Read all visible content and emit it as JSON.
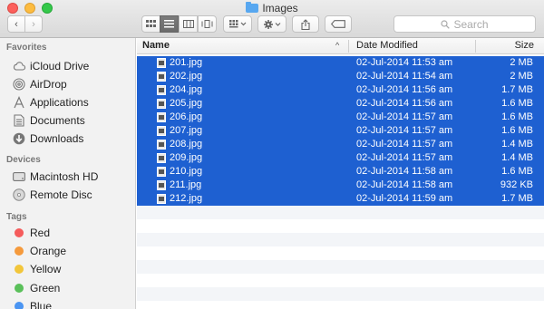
{
  "window": {
    "title": "Images"
  },
  "toolbar": {
    "back_glyph": "‹",
    "forward_glyph": "›",
    "search_placeholder": "Search",
    "view_modes": [
      "icon-view",
      "list-view",
      "column-view",
      "cover-flow-view"
    ],
    "selected_view": "list-view"
  },
  "sidebar": {
    "favorites_header": "Favorites",
    "favorites": [
      {
        "label": "iCloud Drive",
        "icon": "cloud-icon"
      },
      {
        "label": "AirDrop",
        "icon": "airdrop-icon"
      },
      {
        "label": "Applications",
        "icon": "applications-icon"
      },
      {
        "label": "Documents",
        "icon": "documents-icon"
      },
      {
        "label": "Downloads",
        "icon": "downloads-icon"
      }
    ],
    "devices_header": "Devices",
    "devices": [
      {
        "label": "Macintosh HD",
        "icon": "hard-drive-icon"
      },
      {
        "label": "Remote Disc",
        "icon": "disc-icon"
      }
    ],
    "tags_header": "Tags",
    "tags": [
      {
        "label": "Red",
        "color": "#f55c5c"
      },
      {
        "label": "Orange",
        "color": "#f59a3c"
      },
      {
        "label": "Yellow",
        "color": "#f2c63b"
      },
      {
        "label": "Green",
        "color": "#5ac05a"
      },
      {
        "label": "Blue",
        "color": "#4b95f2"
      }
    ]
  },
  "list": {
    "columns": {
      "name": "Name",
      "date": "Date Modified",
      "size": "Size"
    },
    "sort_glyph": "^",
    "selection_color": "#1e60d1",
    "files": [
      {
        "name": "201.jpg",
        "date": "02-Jul-2014 11:53 am",
        "size": "2 MB"
      },
      {
        "name": "202.jpg",
        "date": "02-Jul-2014 11:54 am",
        "size": "2 MB"
      },
      {
        "name": "204.jpg",
        "date": "02-Jul-2014 11:56 am",
        "size": "1.7 MB"
      },
      {
        "name": "205.jpg",
        "date": "02-Jul-2014 11:56 am",
        "size": "1.6 MB"
      },
      {
        "name": "206.jpg",
        "date": "02-Jul-2014 11:57 am",
        "size": "1.6 MB"
      },
      {
        "name": "207.jpg",
        "date": "02-Jul-2014 11:57 am",
        "size": "1.6 MB"
      },
      {
        "name": "208.jpg",
        "date": "02-Jul-2014 11:57 am",
        "size": "1.4 MB"
      },
      {
        "name": "209.jpg",
        "date": "02-Jul-2014 11:57 am",
        "size": "1.4 MB"
      },
      {
        "name": "210.jpg",
        "date": "02-Jul-2014 11:58 am",
        "size": "1.6 MB"
      },
      {
        "name": "211.jpg",
        "date": "02-Jul-2014 11:58 am",
        "size": "932 KB"
      },
      {
        "name": "212.jpg",
        "date": "02-Jul-2014 11:59 am",
        "size": "1.7 MB"
      }
    ]
  }
}
